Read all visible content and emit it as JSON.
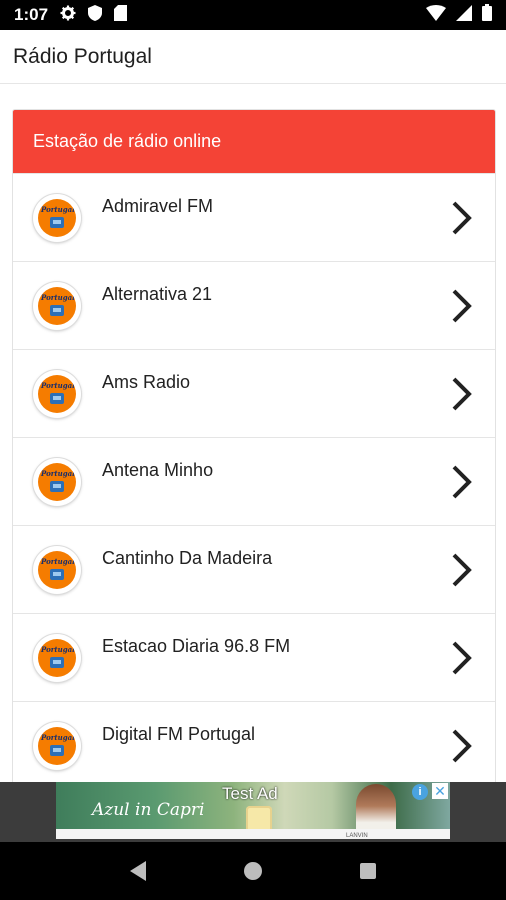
{
  "status_bar": {
    "time": "1:07"
  },
  "app_bar": {
    "title": "Rádio Portugal"
  },
  "section": {
    "header": "Estação de rádio online"
  },
  "stations": [
    {
      "name": "Admiravel FM"
    },
    {
      "name": "Alternativa 21"
    },
    {
      "name": "Ams Radio"
    },
    {
      "name": "Antena Minho"
    },
    {
      "name": "Cantinho Da Madeira"
    },
    {
      "name": "Estacao Diaria 96.8 FM"
    },
    {
      "name": "Digital FM Portugal"
    }
  ],
  "logo_text": "Portugal",
  "ad": {
    "label": "Test Ad",
    "script_text": "Azul in Capri",
    "brand": "LANVIN",
    "info_glyph": "i",
    "close_glyph": "✕"
  },
  "colors": {
    "accent": "#f44336",
    "status_bar": "#000000",
    "ad_background": "#3c3c3c"
  },
  "icons": {
    "row_action": "chevron-right-icon",
    "nav_back": "back-triangle-icon",
    "nav_home": "home-circle-icon",
    "nav_recents": "recents-square-icon"
  }
}
